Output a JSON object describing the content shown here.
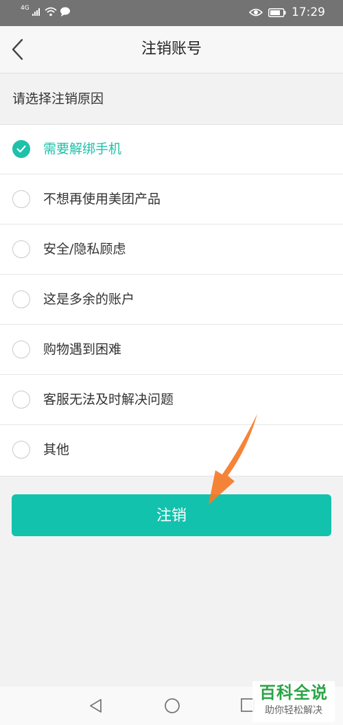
{
  "status_bar": {
    "network": "4G",
    "time": "17:29"
  },
  "header": {
    "title": "注销账号"
  },
  "section": {
    "title": "请选择注销原因"
  },
  "reasons": [
    {
      "label": "需要解绑手机",
      "selected": true
    },
    {
      "label": "不想再使用美团产品",
      "selected": false
    },
    {
      "label": "安全/隐私顾虑",
      "selected": false
    },
    {
      "label": "这是多余的账户",
      "selected": false
    },
    {
      "label": "购物遇到困难",
      "selected": false
    },
    {
      "label": "客服无法及时解决问题",
      "selected": false
    },
    {
      "label": "其他",
      "selected": false
    }
  ],
  "submit": {
    "label": "注销"
  },
  "watermark": {
    "main": "百科全说",
    "sub": "助你轻松解决"
  },
  "colors": {
    "accent": "#13c2ad",
    "annotation_arrow": "#f47b2a"
  },
  "icons": {
    "back": "chevron-left-icon",
    "check": "check-icon",
    "nav_back": "triangle-back-icon",
    "nav_home": "circle-home-icon",
    "nav_recent": "square-recent-icon"
  }
}
